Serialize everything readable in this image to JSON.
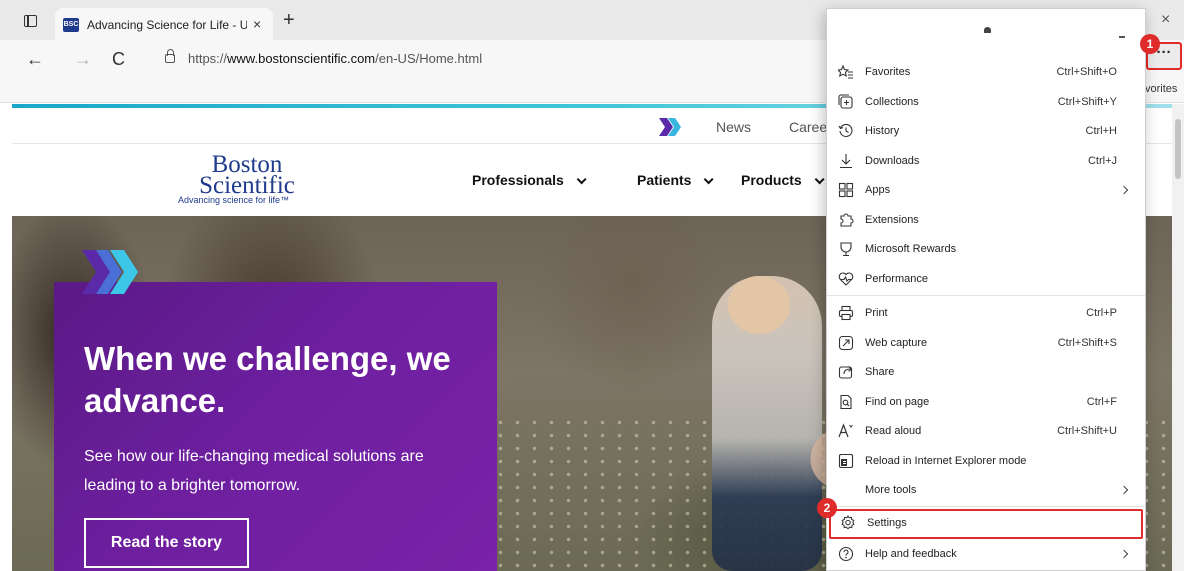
{
  "browser": {
    "tab": {
      "favicon_text": "BSC",
      "title": "Advancing Science for Life - US",
      "close_glyph": "×"
    },
    "new_tab_glyph": "+",
    "window_close_glyph": "×",
    "nav": {
      "back": "←",
      "forward": "→",
      "refresh": "C"
    },
    "address": {
      "prefix": "https://",
      "domain": "www.bostonscientific.com",
      "path": "/en-US/Home.html"
    },
    "more_button": "···",
    "favorites_bar_text": "vorites",
    "accent_color": "#1aa7c9"
  },
  "site": {
    "utility_nav": {
      "news": "News",
      "careers": "Caree"
    },
    "brand": {
      "name_line1": "Boston",
      "name_line2": "Scientific",
      "tagline": "Advancing science for life™",
      "color": "#1f3b8c"
    },
    "main_nav": [
      {
        "label": "Professionals"
      },
      {
        "label": "Patients"
      },
      {
        "label": "Products"
      }
    ],
    "hero": {
      "title": "When we challenge, we advance.",
      "subtitle": "See how our life-changing medical solutions are leading to a brighter tomorrow.",
      "cta": "Read the story",
      "panel_color": "#6d1f9e"
    }
  },
  "menu": {
    "items": [
      {
        "icon": "favorites-icon",
        "label": "Favorites",
        "shortcut": "Ctrl+Shift+O"
      },
      {
        "icon": "collections-icon",
        "label": "Collections",
        "shortcut": "Ctrl+Shift+Y"
      },
      {
        "icon": "history-icon",
        "label": "History",
        "shortcut": "Ctrl+H"
      },
      {
        "icon": "downloads-icon",
        "label": "Downloads",
        "shortcut": "Ctrl+J"
      },
      {
        "icon": "apps-icon",
        "label": "Apps",
        "shortcut": ""
      },
      {
        "icon": "extensions-icon",
        "label": "Extensions",
        "shortcut": ""
      },
      {
        "icon": "rewards-icon",
        "label": "Microsoft Rewards",
        "shortcut": ""
      },
      {
        "icon": "performance-icon",
        "label": "Performance",
        "shortcut": ""
      },
      {
        "icon": "print-icon",
        "label": "Print",
        "shortcut": "Ctrl+P"
      },
      {
        "icon": "web-capture-icon",
        "label": "Web capture",
        "shortcut": "Ctrl+Shift+S"
      },
      {
        "icon": "share-icon",
        "label": "Share",
        "shortcut": ""
      },
      {
        "icon": "find-icon",
        "label": "Find on page",
        "shortcut": "Ctrl+F"
      },
      {
        "icon": "read-aloud-icon",
        "label": "Read aloud",
        "shortcut": "Ctrl+Shift+U"
      },
      {
        "icon": "ie-mode-icon",
        "label": "Reload in Internet Explorer mode",
        "shortcut": ""
      },
      {
        "icon": "more-tools-icon",
        "label": "More tools",
        "shortcut": ""
      },
      {
        "icon": "settings-icon",
        "label": "Settings",
        "shortcut": ""
      },
      {
        "icon": "help-icon",
        "label": "Help and feedback",
        "shortcut": ""
      }
    ],
    "highlight_color": "#e02b2b"
  },
  "annotations": {
    "step1": "1",
    "step2": "2"
  }
}
